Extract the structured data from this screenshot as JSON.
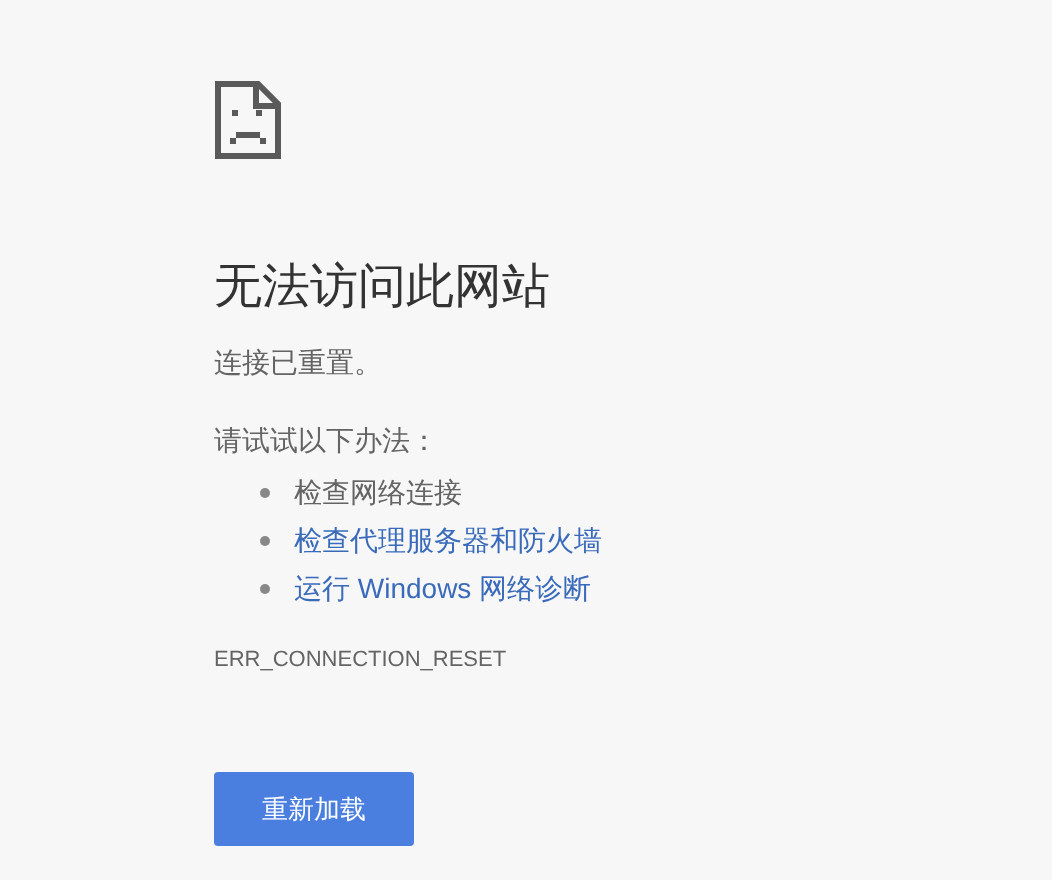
{
  "title": "无法访问此网站",
  "message": "连接已重置。",
  "suggestions": {
    "heading": "请试试以下办法：",
    "items": [
      {
        "kind": "text",
        "label": "检查网络连接"
      },
      {
        "kind": "link",
        "label": "检查代理服务器和防火墙"
      },
      {
        "kind": "link",
        "label": "运行 Windows 网络诊断"
      }
    ]
  },
  "error_code": "ERR_CONNECTION_RESET",
  "button": "重新加载"
}
